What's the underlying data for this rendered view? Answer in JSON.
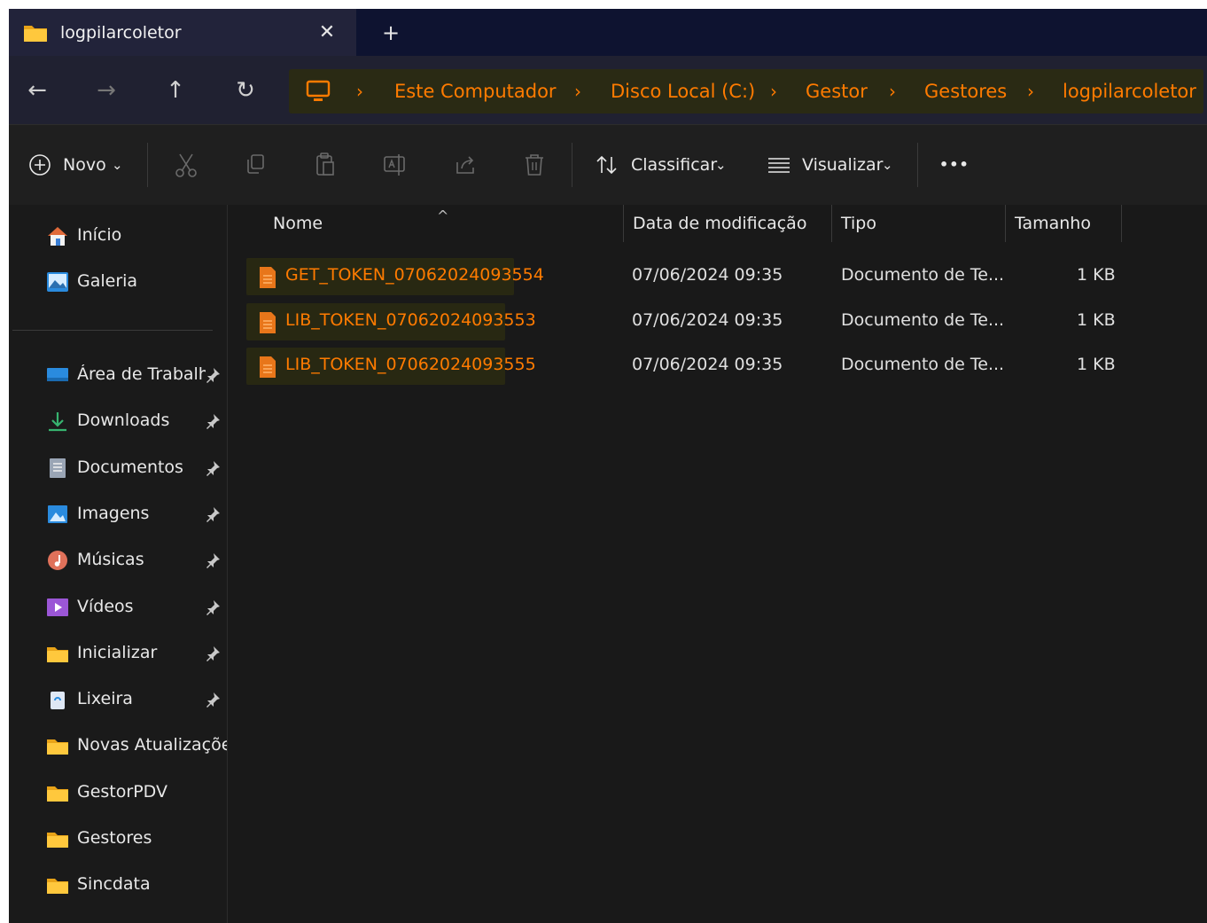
{
  "window": {
    "tab_title": "logpilarcoletor",
    "tab_close": "✕",
    "new_tab": "+"
  },
  "nav": {
    "back": "←",
    "forward": "→",
    "up": "↑",
    "refresh": "↻",
    "separator": "›",
    "breadcrumbs": [
      "Este Computador",
      "Disco Local (C:)",
      "Gestor",
      "Gestores",
      "logpilarcoletor"
    ]
  },
  "commands": {
    "new_label": "Novo",
    "sort_label": "Classificar",
    "view_label": "Visualizar",
    "more": "•••",
    "dropdown": "⌄"
  },
  "sidebar": {
    "home": "Início",
    "gallery": "Galeria",
    "items": [
      {
        "label": "Área de Trabalho",
        "icon": "desktop-icon",
        "pinned": true
      },
      {
        "label": "Downloads",
        "icon": "downloads-icon",
        "pinned": true
      },
      {
        "label": "Documentos",
        "icon": "documents-icon",
        "pinned": true
      },
      {
        "label": "Imagens",
        "icon": "pictures-icon",
        "pinned": true
      },
      {
        "label": "Músicas",
        "icon": "music-icon",
        "pinned": true
      },
      {
        "label": "Vídeos",
        "icon": "videos-icon",
        "pinned": true
      },
      {
        "label": "Inicializar",
        "icon": "folder-icon",
        "pinned": true
      },
      {
        "label": "Lixeira",
        "icon": "recycle-bin-icon",
        "pinned": true
      },
      {
        "label": "Novas Atualizações",
        "icon": "folder-icon",
        "pinned": false
      },
      {
        "label": "GestorPDV",
        "icon": "folder-icon",
        "pinned": false
      },
      {
        "label": "Gestores",
        "icon": "folder-icon",
        "pinned": false
      },
      {
        "label": "Sincdata",
        "icon": "folder-icon",
        "pinned": false
      }
    ]
  },
  "files": {
    "columns": {
      "name": "Nome",
      "date": "Data de modificação",
      "type": "Tipo",
      "size": "Tamanho"
    },
    "sort_indicator": "^",
    "rows": [
      {
        "name": "GET_TOKEN_07062024093554",
        "date": "07/06/2024 09:35",
        "type": "Documento de Te...",
        "size": "1 KB"
      },
      {
        "name": "LIB_TOKEN_07062024093553",
        "date": "07/06/2024 09:35",
        "type": "Documento de Te...",
        "size": "1 KB"
      },
      {
        "name": "LIB_TOKEN_07062024093555",
        "date": "07/06/2024 09:35",
        "type": "Documento de Te...",
        "size": "1 KB"
      }
    ]
  },
  "colors": {
    "accent_orange": "#ff7b00",
    "window_bg": "#191919",
    "titlebar_bg": "#0e1330",
    "highlight_bg": "#2a2a14"
  }
}
